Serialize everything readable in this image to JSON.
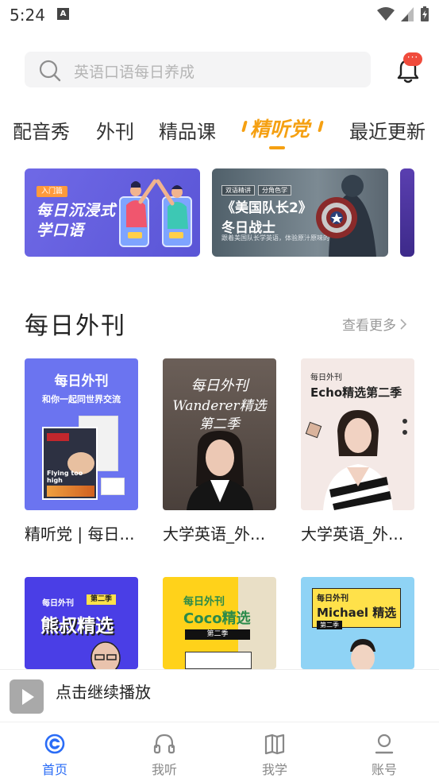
{
  "status": {
    "time": "5:24"
  },
  "search": {
    "placeholder": "英语口语每日养成"
  },
  "notifications": {
    "badge": "···"
  },
  "tabs": [
    {
      "label": "配音秀"
    },
    {
      "label": "外刊"
    },
    {
      "label": "精品课"
    },
    {
      "label": "精听党"
    },
    {
      "label": "最近更新"
    }
  ],
  "banners": {
    "b1": {
      "tag": "入门篇",
      "line1": "每日沉浸式",
      "line2": "学口语"
    },
    "b2": {
      "tag1": "双语精讲",
      "tag2": "分角色学",
      "title": "《美国队长2》",
      "subtitle": "冬日战士",
      "desc": "跟着美国队长学英语，体验原汁原味的美语"
    }
  },
  "section": {
    "title": "每日外刊",
    "more": "查看更多"
  },
  "cards_row1": [
    {
      "title": "精听党 | 每日...",
      "cover_title": "每日外刊",
      "cover_sub": "和你一起同世界交流",
      "cover_caption": "Flying too high"
    },
    {
      "title": "大学英语_外...",
      "cover_line1": "每日外刊",
      "cover_line2": "Wanderer精选",
      "cover_line3": "第二季"
    },
    {
      "title": "大学英语_外...",
      "cover_small": "每日外刊",
      "cover_line": "Echo精选第二季"
    }
  ],
  "cards_row2": [
    {
      "cover_small": "每日外刊",
      "cover_badge": "第二季",
      "cover_title": "熊叔精选"
    },
    {
      "cover_small": "每日外刊",
      "cover_title": "Coco精选",
      "cover_badge": "第二季"
    },
    {
      "cover_small": "每日外刊",
      "cover_title": "Michael 精选",
      "cover_badge": "第二季"
    }
  ],
  "player": {
    "text": "点击继续播放"
  },
  "nav": [
    {
      "label": "首页"
    },
    {
      "label": "我听"
    },
    {
      "label": "我学"
    },
    {
      "label": "账号"
    }
  ],
  "colors": {
    "accent": "#f5a012",
    "nav_active": "#2a6cf6",
    "badge": "#f04b3c"
  }
}
